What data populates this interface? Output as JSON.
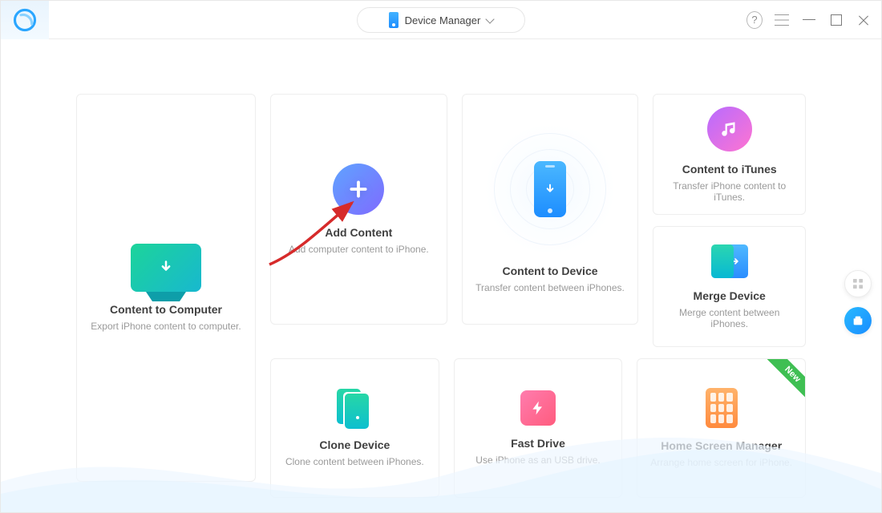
{
  "titlebar": {
    "dropdown_label": "Device Manager"
  },
  "cards": {
    "to_computer": {
      "title": "Content to Computer",
      "desc": "Export iPhone content to computer."
    },
    "add_content": {
      "title": "Add Content",
      "desc": "Add computer content to iPhone."
    },
    "to_device": {
      "title": "Content to Device",
      "desc": "Transfer content between iPhones."
    },
    "to_itunes": {
      "title": "Content to iTunes",
      "desc": "Transfer iPhone content to iTunes."
    },
    "merge": {
      "title": "Merge Device",
      "desc": "Merge content between iPhones."
    },
    "clone": {
      "title": "Clone Device",
      "desc": "Clone content between iPhones."
    },
    "fast_drive": {
      "title": "Fast Drive",
      "desc": "Use iPhone as an USB drive."
    },
    "home_screen": {
      "title": "Home Screen Manager",
      "desc": "Arrange home screen for iPhone."
    }
  },
  "ribbon_new": "New"
}
